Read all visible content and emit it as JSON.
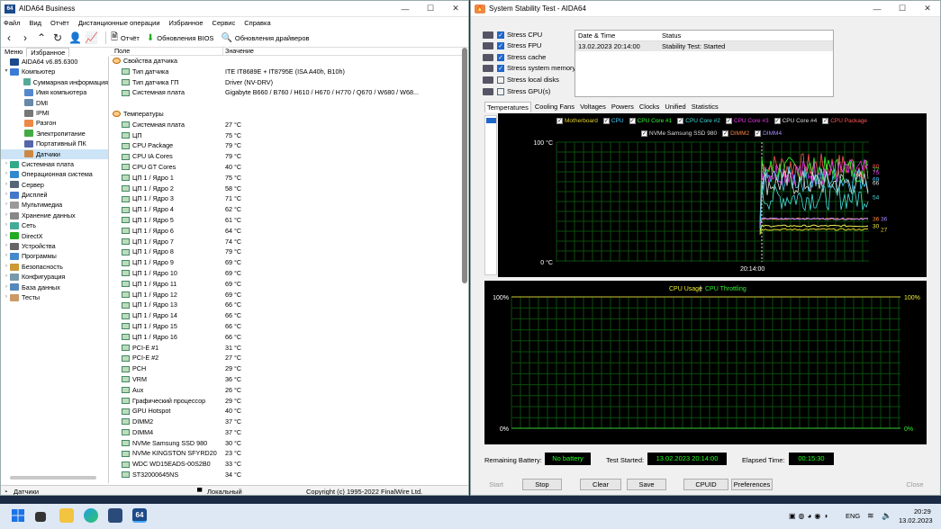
{
  "aida": {
    "title": "AIDA64 Business",
    "menu": [
      "Файл",
      "Вид",
      "Отчёт",
      "Дистанционные операции",
      "Избранное",
      "Сервис",
      "Справка"
    ],
    "toolbar": {
      "report": "Отчёт",
      "bios": "Обновления BIOS",
      "drivers": "Обновления драйверов"
    },
    "panes": {
      "menu": "Меню",
      "fav": "Избранное"
    },
    "tree": [
      {
        "label": "AIDA64 v6.85.6300",
        "lvl": 0,
        "exp": "",
        "color": "#1c4a8a"
      },
      {
        "label": "Компьютер",
        "lvl": 1,
        "exp": "▾",
        "color": "#3a7bd5"
      },
      {
        "label": "Суммарная информация",
        "lvl": 2,
        "exp": "",
        "color": "#5a9"
      },
      {
        "label": "Имя компьютера",
        "lvl": 2,
        "exp": "",
        "color": "#58c"
      },
      {
        "label": "DMI",
        "lvl": 2,
        "exp": "",
        "color": "#68a"
      },
      {
        "label": "IPMI",
        "lvl": 2,
        "exp": "",
        "color": "#777"
      },
      {
        "label": "Разгон",
        "lvl": 2,
        "exp": "",
        "color": "#e84"
      },
      {
        "label": "Электропитание",
        "lvl": 2,
        "exp": "",
        "color": "#4a4"
      },
      {
        "label": "Портативный ПК",
        "lvl": 2,
        "exp": "",
        "color": "#56a"
      },
      {
        "label": "Датчики",
        "lvl": 2,
        "exp": "",
        "color": "#c84",
        "sel": true
      },
      {
        "label": "Системная плата",
        "lvl": 1,
        "exp": "›",
        "color": "#3a8"
      },
      {
        "label": "Операционная система",
        "lvl": 1,
        "exp": "›",
        "color": "#38c"
      },
      {
        "label": "Сервер",
        "lvl": 1,
        "exp": "›",
        "color": "#567"
      },
      {
        "label": "Дисплей",
        "lvl": 1,
        "exp": "›",
        "color": "#47c"
      },
      {
        "label": "Мультимедиа",
        "lvl": 1,
        "exp": "›",
        "color": "#999"
      },
      {
        "label": "Хранение данных",
        "lvl": 1,
        "exp": "›",
        "color": "#888"
      },
      {
        "label": "Сеть",
        "lvl": 1,
        "exp": "›",
        "color": "#4a9"
      },
      {
        "label": "DirectX",
        "lvl": 1,
        "exp": "›",
        "color": "#2a2"
      },
      {
        "label": "Устройства",
        "lvl": 1,
        "exp": "›",
        "color": "#666"
      },
      {
        "label": "Программы",
        "lvl": 1,
        "exp": "›",
        "color": "#48c"
      },
      {
        "label": "Безопасность",
        "lvl": 1,
        "exp": "›",
        "color": "#c93"
      },
      {
        "label": "Конфигурация",
        "lvl": 1,
        "exp": "›",
        "color": "#79a"
      },
      {
        "label": "База данных",
        "lvl": 1,
        "exp": "›",
        "color": "#58b"
      },
      {
        "label": "Тесты",
        "lvl": 1,
        "exp": "›",
        "color": "#c96"
      }
    ],
    "columns": {
      "field": "Поле",
      "value": "Значение"
    },
    "rows": [
      {
        "f": "Свойства датчика",
        "v": "",
        "grp": true
      },
      {
        "f": "Тип датчика",
        "v": "ITE IT8689E + IT8795E  (ISA A40h, B10h)"
      },
      {
        "f": "Тип датчика ГП",
        "v": "Driver  (NV-DRV)"
      },
      {
        "f": "Системная плата",
        "v": "Gigabyte B660 / B760 / H610 / H670 / H770 / Q670 / W680 / W68..."
      },
      {
        "f": "",
        "v": ""
      },
      {
        "f": "Температуры",
        "v": "",
        "grp": true
      },
      {
        "f": "Системная плата",
        "v": "27 °C"
      },
      {
        "f": "ЦП",
        "v": "75 °C"
      },
      {
        "f": "CPU Package",
        "v": "79 °C"
      },
      {
        "f": "CPU IA Cores",
        "v": "79 °C"
      },
      {
        "f": "CPU GT Cores",
        "v": "40 °C"
      },
      {
        "f": "ЦП 1 / Ядро 1",
        "v": "75 °C"
      },
      {
        "f": "ЦП 1 / Ядро 2",
        "v": "58 °C"
      },
      {
        "f": "ЦП 1 / Ядро 3",
        "v": "71 °C"
      },
      {
        "f": "ЦП 1 / Ядро 4",
        "v": "62 °C"
      },
      {
        "f": "ЦП 1 / Ядро 5",
        "v": "61 °C"
      },
      {
        "f": "ЦП 1 / Ядро 6",
        "v": "64 °C"
      },
      {
        "f": "ЦП 1 / Ядро 7",
        "v": "74 °C"
      },
      {
        "f": "ЦП 1 / Ядро 8",
        "v": "79 °C"
      },
      {
        "f": "ЦП 1 / Ядро 9",
        "v": "69 °C"
      },
      {
        "f": "ЦП 1 / Ядро 10",
        "v": "69 °C"
      },
      {
        "f": "ЦП 1 / Ядро 11",
        "v": "69 °C"
      },
      {
        "f": "ЦП 1 / Ядро 12",
        "v": "69 °C"
      },
      {
        "f": "ЦП 1 / Ядро 13",
        "v": "66 °C"
      },
      {
        "f": "ЦП 1 / Ядро 14",
        "v": "66 °C"
      },
      {
        "f": "ЦП 1 / Ядро 15",
        "v": "66 °C"
      },
      {
        "f": "ЦП 1 / Ядро 16",
        "v": "66 °C"
      },
      {
        "f": "PCI-E #1",
        "v": "31 °C"
      },
      {
        "f": "PCI-E #2",
        "v": "27 °C"
      },
      {
        "f": "PCH",
        "v": "29 °C"
      },
      {
        "f": "VRM",
        "v": "36 °C"
      },
      {
        "f": "Aux",
        "v": "26 °C"
      },
      {
        "f": "Графический процессор",
        "v": "29 °C"
      },
      {
        "f": "GPU Hotspot",
        "v": "40 °C"
      },
      {
        "f": "DIMM2",
        "v": "37 °C"
      },
      {
        "f": "DIMM4",
        "v": "37 °C"
      },
      {
        "f": "NVMe Samsung SSD 980",
        "v": "30 °C"
      },
      {
        "f": "NVMe KINGSTON SFYRD20",
        "v": "23 °C"
      },
      {
        "f": "WDC WD15EADS-00S2B0",
        "v": "33 °C"
      },
      {
        "f": "ST32000645NS",
        "v": "34 °C"
      }
    ],
    "status": {
      "left": "Датчики",
      "mid": "Локальный",
      "right": "Copyright (c) 1995-2022 FinalWire Ltd."
    }
  },
  "sst": {
    "title": "System Stability Test - AIDA64",
    "checks": [
      {
        "label": "Stress CPU",
        "on": true
      },
      {
        "label": "Stress FPU",
        "on": true
      },
      {
        "label": "Stress cache",
        "on": true
      },
      {
        "label": "Stress system memory",
        "on": true
      },
      {
        "label": "Stress local disks",
        "on": false
      },
      {
        "label": "Stress GPU(s)",
        "on": false
      }
    ],
    "status_head": {
      "dt": "Date & Time",
      "st": "Status"
    },
    "status_row": {
      "dt": "13.02.2023 20:14:00",
      "st": "Stability Test: Started"
    },
    "tabs": [
      "Temperatures",
      "Cooling Fans",
      "Voltages",
      "Powers",
      "Clocks",
      "Unified",
      "Statistics"
    ],
    "legend1": [
      {
        "label": "Motherboard",
        "color": "#e0d030"
      },
      {
        "label": "CPU",
        "color": "#4cf"
      },
      {
        "label": "CPU Core #1",
        "color": "#3f3"
      },
      {
        "label": "CPU Core #2",
        "color": "#4dd"
      },
      {
        "label": "CPU Core #3",
        "color": "#e3e"
      },
      {
        "label": "CPU Core #4",
        "color": "#ddd"
      },
      {
        "label": "CPU Package",
        "color": "#f55"
      }
    ],
    "legend2": [
      {
        "label": "NVMe Samsung SSD 980",
        "color": "#ddd"
      },
      {
        "label": "DIMM2",
        "color": "#f84"
      },
      {
        "label": "DIMM4",
        "color": "#a8f"
      }
    ],
    "temp_chart": {
      "ymax": "100 °C",
      "ymin": "0 °C",
      "xlabel": "20:14:00"
    },
    "usage_chart": {
      "ymax_l": "100%",
      "ymin_l": "0%",
      "ymax_r": "100%",
      "ymin_r": "0%",
      "title_a": "CPU Usage",
      "title_sep": "|",
      "title_b": "CPU Throttling"
    },
    "bottom": {
      "battery_label": "Remaining Battery:",
      "battery": "No battery",
      "started_label": "Test Started:",
      "started": "13.02.2023 20:14:00",
      "elapsed_label": "Elapsed Time:",
      "elapsed": "00:15:30"
    },
    "buttons": {
      "start": "Start",
      "stop": "Stop",
      "clear": "Clear",
      "save": "Save",
      "cpuid": "CPUID",
      "prefs": "Preferences",
      "close": "Close"
    }
  },
  "chart_data": {
    "type": "line",
    "title": "",
    "xlabel": "20:14:00",
    "ylabel": "",
    "ylim": [
      0,
      100
    ],
    "series": [
      {
        "name": "CPU Package",
        "end_value": 80,
        "color": "#f55"
      },
      {
        "name": "CPU Core #1",
        "end_value": 77,
        "color": "#3f3"
      },
      {
        "name": "CPU Core #3",
        "end_value": 75,
        "color": "#e3e"
      },
      {
        "name": "CPU",
        "end_value": 69,
        "color": "#4cf"
      },
      {
        "name": "CPU Core #4",
        "end_value": 66,
        "color": "#ddd"
      },
      {
        "name": "CPU Core #2",
        "end_value": 54,
        "color": "#4dd"
      },
      {
        "name": "DIMM2",
        "end_value": 36,
        "color": "#f84"
      },
      {
        "name": "DIMM4",
        "end_value": 36,
        "color": "#a8f"
      },
      {
        "name": "NVMe Samsung SSD 980",
        "end_value": 30,
        "color": "#ee5"
      },
      {
        "name": "Motherboard",
        "end_value": 27,
        "color": "#e0d030"
      }
    ]
  },
  "taskbar": {
    "lang": "ENG",
    "time": "20:29",
    "date": "13.02.2023"
  }
}
